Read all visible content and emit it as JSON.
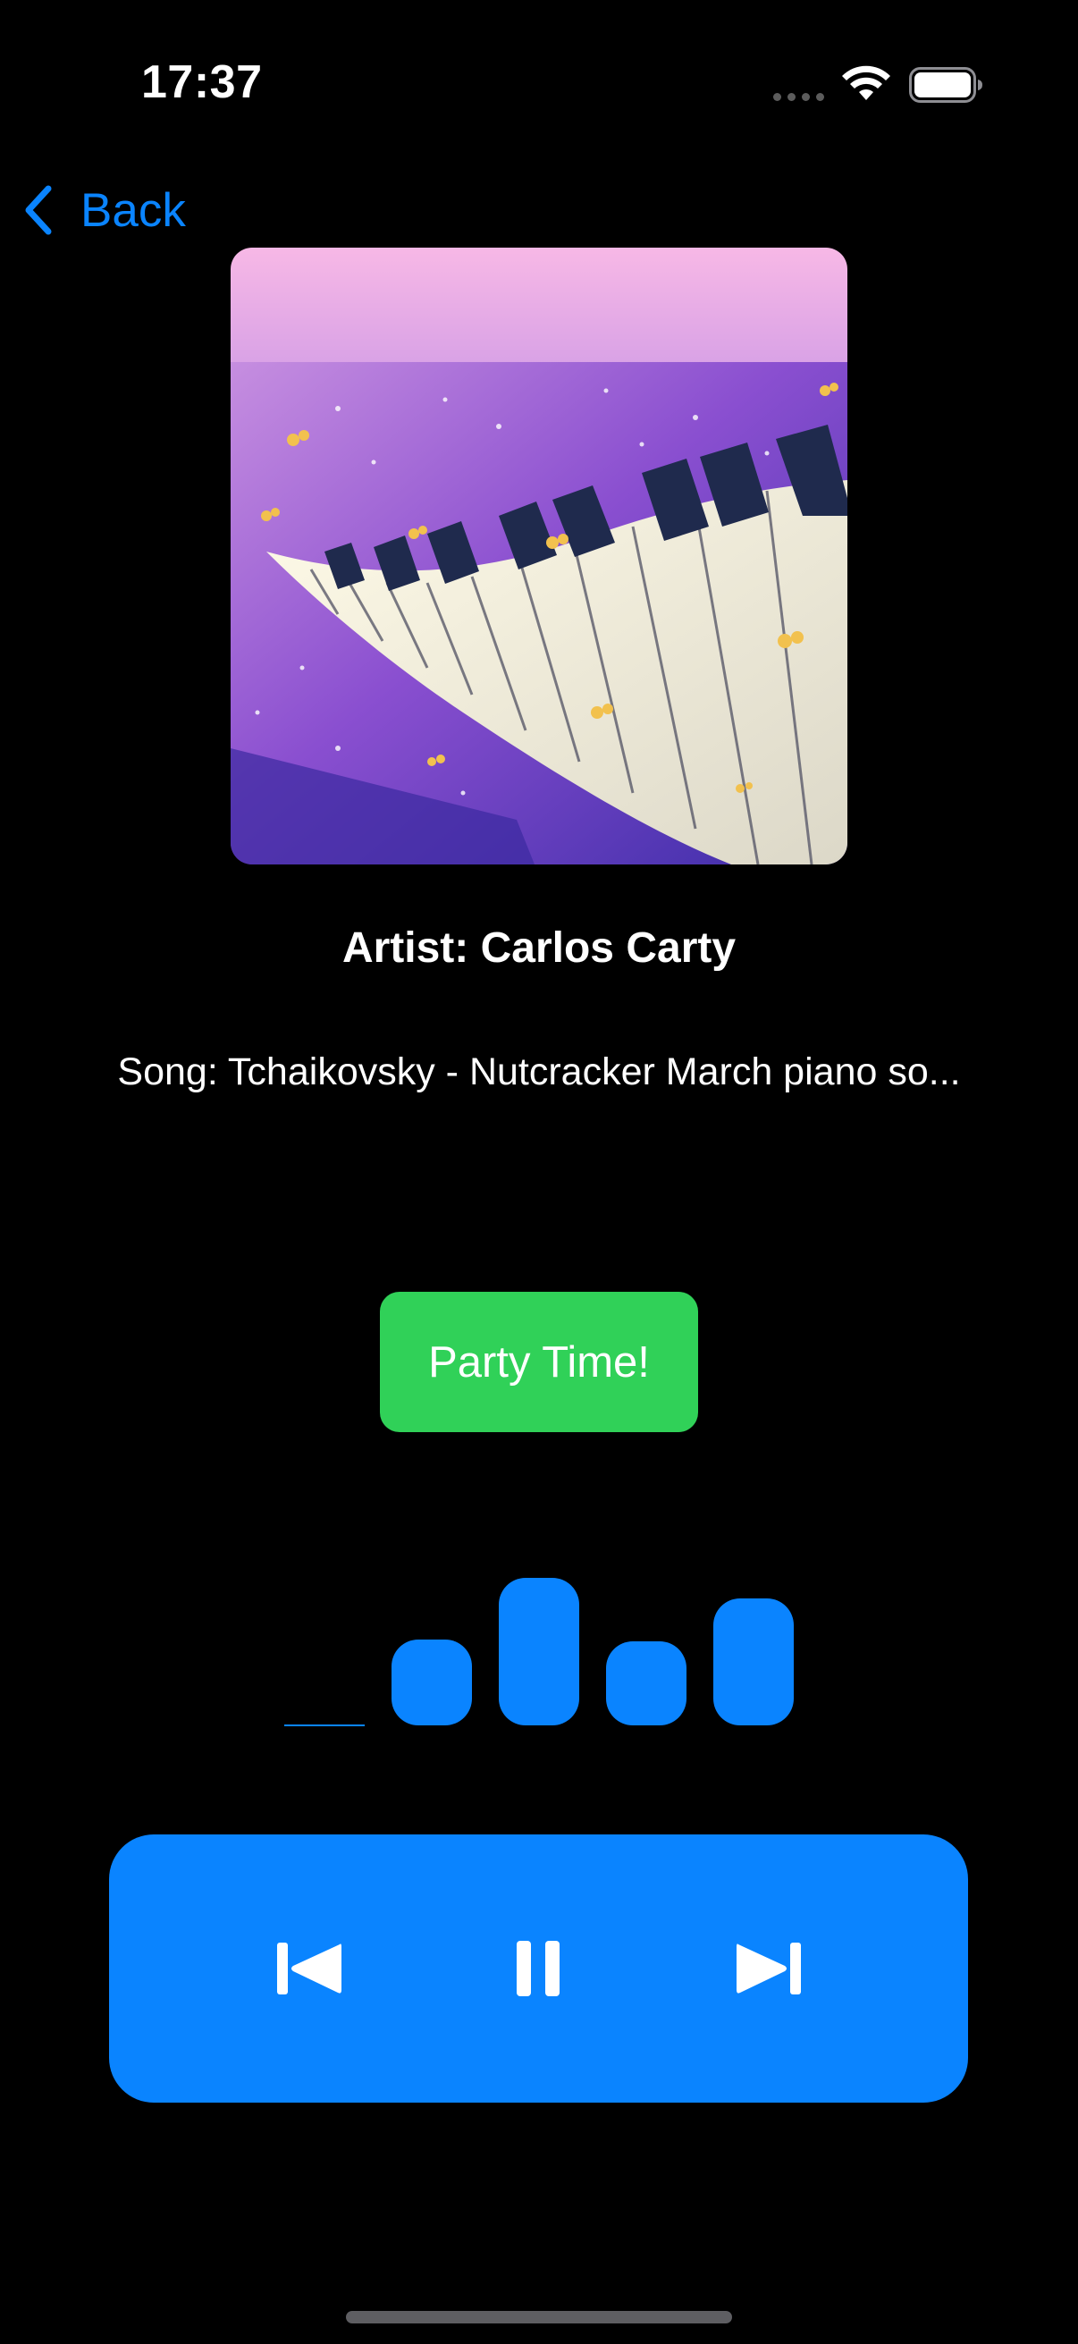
{
  "status_bar": {
    "time": "17:37",
    "icons": [
      "cellular-signal-icon",
      "wifi-icon",
      "battery-icon"
    ]
  },
  "nav": {
    "back_label": "Back",
    "back_icon": "chevron-left-icon"
  },
  "now_playing": {
    "artwork_icon": "album-artwork-piano-butterflies",
    "artist": "Artist: Carlos Carty",
    "song": "Song: Tchaikovsky - Nutcracker March piano so..."
  },
  "party_button": {
    "label": "Party Time!"
  },
  "visualizer": {
    "bar_levels": [
      0,
      0.58,
      1.0,
      0.57,
      0.86
    ]
  },
  "playback_controls": {
    "previous_icon": "backward-end-icon",
    "pause_icon": "pause-icon",
    "next_icon": "forward-end-icon"
  },
  "colors": {
    "accent_blue": "#0a84ff",
    "party_green": "#30d158",
    "background": "#000000",
    "text": "#ffffff"
  }
}
